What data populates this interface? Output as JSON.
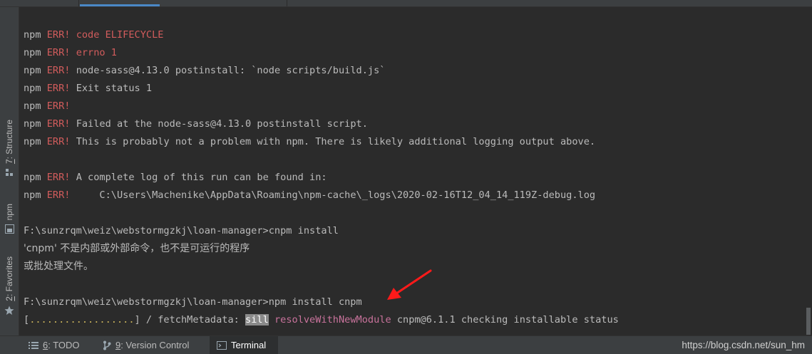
{
  "left_toolbar": {
    "structure": {
      "number": "7",
      "label": ": Structure"
    },
    "npm": {
      "label": "npm"
    },
    "favorites": {
      "number": "2",
      "label": ": Favorites"
    }
  },
  "terminal": {
    "lines": [
      {
        "prefix": "npm",
        "err": "ERR!",
        "text": "code ELIFECYCLE",
        "text_color": "#d25c5c"
      },
      {
        "prefix": "npm",
        "err": "ERR!",
        "text": "errno 1",
        "text_color": "#d25c5c"
      },
      {
        "prefix": "npm",
        "err": "ERR!",
        "text": "node-sass@4.13.0 postinstall: `node scripts/build.js`"
      },
      {
        "prefix": "npm",
        "err": "ERR!",
        "text": "Exit status 1"
      },
      {
        "prefix": "npm",
        "err": "ERR!",
        "text": ""
      },
      {
        "prefix": "npm",
        "err": "ERR!",
        "text": "Failed at the node-sass@4.13.0 postinstall script."
      },
      {
        "prefix": "npm",
        "err": "ERR!",
        "text": "This is probably not a problem with npm. There is likely additional logging output above."
      },
      {
        "prefix": "npm",
        "err": "ERR!",
        "text": "A complete log of this run can be found in:"
      },
      {
        "prefix": "npm",
        "err": "ERR!",
        "text": "    C:\\Users\\Machenike\\AppData\\Roaming\\npm-cache\\_logs\\2020-02-16T12_04_14_119Z-debug.log"
      },
      {
        "text": "F:\\sunzrqm\\weiz\\webstormgzkj\\loan-manager>cnpm install"
      },
      {
        "text": "'cnpm' 不是内部或外部命令，也不是可运行的程序"
      },
      {
        "text": "或批处理文件。"
      },
      {
        "text": "F:\\sunzrqm\\weiz\\webstormgzkj\\loan-manager>npm install cnpm"
      }
    ],
    "progress": {
      "open": "[",
      "dots": "..................",
      "close": "] / fetchMetadata: ",
      "level": "sill",
      "func": "resolveWithNewModule",
      "rest": " cnpm@6.1.1 checking installable status"
    }
  },
  "bottom_toolbar": {
    "todo": {
      "number": "6",
      "label": ": TODO"
    },
    "vcs": {
      "number": "9",
      "label": ": Version Control"
    },
    "terminal": {
      "label": "Terminal"
    }
  },
  "watermark": "https://blog.csdn.net/sun_hm",
  "colors": {
    "background": "#2b2b2b",
    "error": "#d25c5c",
    "text": "#bbbbbb",
    "annotation_arrow": "#ff1a1a"
  }
}
